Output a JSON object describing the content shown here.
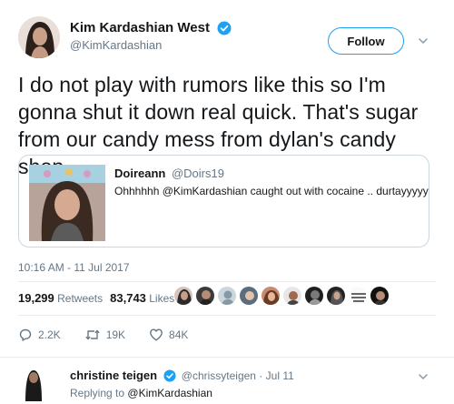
{
  "tweet": {
    "author_name": "Kim Kardashian West",
    "author_handle": "@KimKardashian",
    "follow_label": "Follow",
    "text": "I do not play with rumors like this so I'm gonna shut it down real quick. That's sugar from our candy mess from dylan's candy shop",
    "quote": {
      "author_name": "Doireann",
      "author_handle": "@Doirs19",
      "text": "Ohhhhhh @KimKardashian caught out with cocaine .. durtayyyyy"
    },
    "timestamp": "10:16 AM - 11 Jul 2017",
    "stats": {
      "retweets_count": "19,299",
      "retweets_label": "Retweets",
      "likes_count": "83,743",
      "likes_label": "Likes"
    },
    "actions": {
      "reply_count": "2.2K",
      "retweet_count": "19K",
      "like_count": "84K"
    }
  },
  "reply": {
    "author_name": "christine teigen",
    "author_handle": "@chrissyteigen",
    "time": "· Jul 11",
    "replying_to_label": "Replying to",
    "replying_to_handle": "@KimKardashian"
  },
  "colors": {
    "accent": "#1da1f2",
    "text": "#14171a",
    "secondary": "#657786",
    "border": "#e6ecf0"
  },
  "icons": [
    "verified-badge-icon",
    "chevron-down-icon",
    "reply-icon",
    "retweet-icon",
    "heart-icon"
  ]
}
